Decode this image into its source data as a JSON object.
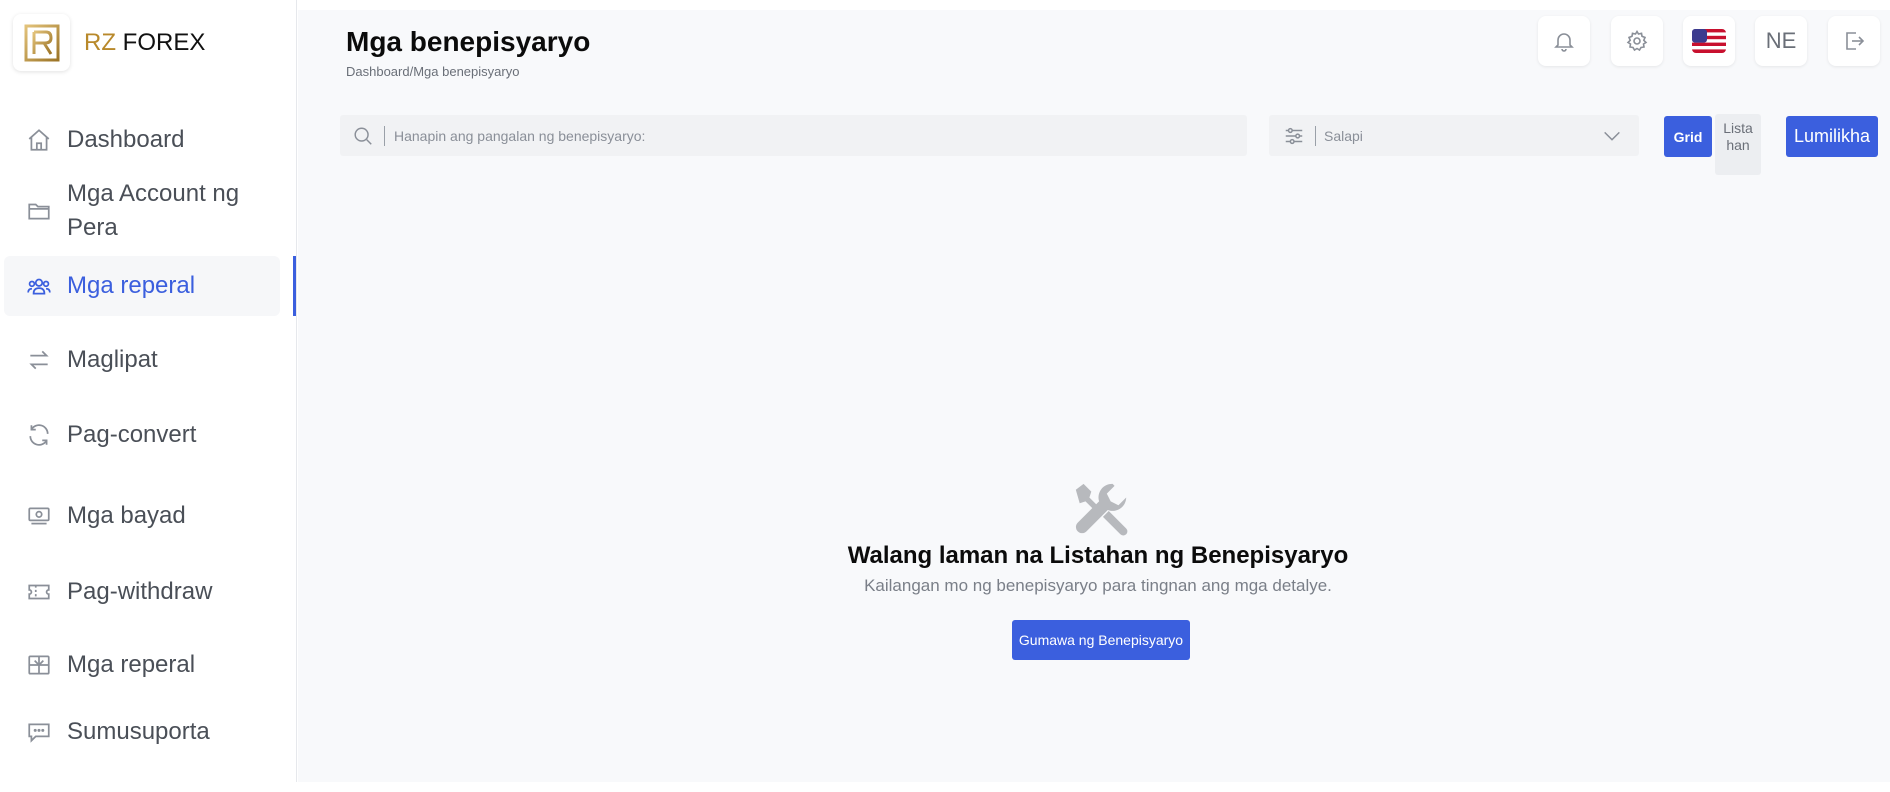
{
  "brand": {
    "prefix": "RZ",
    "name": "FOREX"
  },
  "sidebar": {
    "items": [
      {
        "label": "Dashboard",
        "icon": "home-icon"
      },
      {
        "label": "Mga Account ng Pera",
        "icon": "folder-icon"
      },
      {
        "label": "Mga reperal",
        "icon": "users-icon",
        "active": true
      },
      {
        "label": "Maglipat",
        "icon": "transfer-icon"
      },
      {
        "label": "Pag-convert",
        "icon": "refresh-icon"
      },
      {
        "label": "Mga bayad",
        "icon": "cash-icon"
      },
      {
        "label": "Pag-withdraw",
        "icon": "ticket-icon"
      },
      {
        "label": "Mga reperal",
        "icon": "gift-icon"
      },
      {
        "label": "Sumusuporta",
        "icon": "chat-icon"
      }
    ]
  },
  "header": {
    "title": "Mga benepisyaryo",
    "breadcrumb": "Dashboard/Mga benepisyaryo",
    "user_initials": "NE"
  },
  "toolbar": {
    "search_placeholder": "Hanapin ang pangalan ng benepisyaryo:",
    "currency_placeholder": "Salapi",
    "grid_label": "Grid",
    "list_label": "Listahan",
    "create_label": "Lumilikha"
  },
  "empty_state": {
    "title": "Walang laman na Listahan ng Benepisyaryo",
    "subtitle": "Kailangan mo ng benepisyaryo para tingnan ang mga detalye.",
    "button_label": "Gumawa ng Benepisyaryo"
  },
  "colors": {
    "accent": "#3b5fde",
    "brand_gold": "#b8892b"
  }
}
